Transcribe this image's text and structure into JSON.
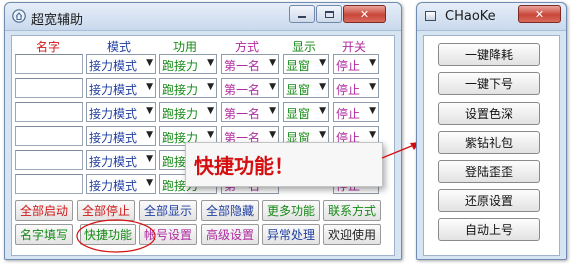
{
  "main_window": {
    "title": "超宽辅助",
    "minimize_icon": "minimize-icon",
    "maximize_icon": "maximize-icon",
    "close_icon": "close-icon",
    "columns": [
      {
        "label": "名字",
        "color": "#d01818"
      },
      {
        "label": "模式",
        "color": "#1f3fa0"
      },
      {
        "label": "功用",
        "color": "#158a15"
      },
      {
        "label": "方式",
        "color": "#b02aa0"
      },
      {
        "label": "显示",
        "color": "#158a15"
      },
      {
        "label": "开关",
        "color": "#b02aa0"
      }
    ],
    "rows": [
      {
        "name": "",
        "mode": "接力模式",
        "function": "跑接力",
        "method": "第一名",
        "display": "显窗",
        "switch": "停止"
      },
      {
        "name": "",
        "mode": "接力模式",
        "function": "跑接力",
        "method": "第一名",
        "display": "显窗",
        "switch": "停止"
      },
      {
        "name": "",
        "mode": "接力模式",
        "function": "跑接力",
        "method": "第一名",
        "display": "显窗",
        "switch": "停止"
      },
      {
        "name": "",
        "mode": "接力模式",
        "function": "跑接力",
        "method": "第一名",
        "display": "显窗",
        "switch": "停止"
      },
      {
        "name": "",
        "mode": "接力模式",
        "function": "跑接力",
        "method": "",
        "display": "",
        "switch": "停止"
      },
      {
        "name": "",
        "mode": "接力模式",
        "function": "跑接力",
        "method": "第一名",
        "display": "",
        "switch": "停止"
      }
    ],
    "button_row1": [
      "全部启动",
      "全部停止",
      "全部显示",
      "全部隐藏",
      "更多功能",
      "联系方式"
    ],
    "button_row2": [
      "名字填写",
      "快捷功能",
      "帐号设置",
      "高级设置",
      "异常处理",
      "欢迎使用"
    ]
  },
  "popup_label": "快捷功能！",
  "quick_window": {
    "title": "CHaoKe",
    "buttons": [
      "一键降耗",
      "一键下号",
      "设置色深",
      "紫钻礼包",
      "登陆歪歪",
      "还原设置",
      "自动上号"
    ]
  },
  "colors": {
    "red": "#d01818",
    "blue": "#1f3fa0",
    "green": "#158a15",
    "purple": "#b02aa0",
    "annotation": "#d50f0f"
  }
}
